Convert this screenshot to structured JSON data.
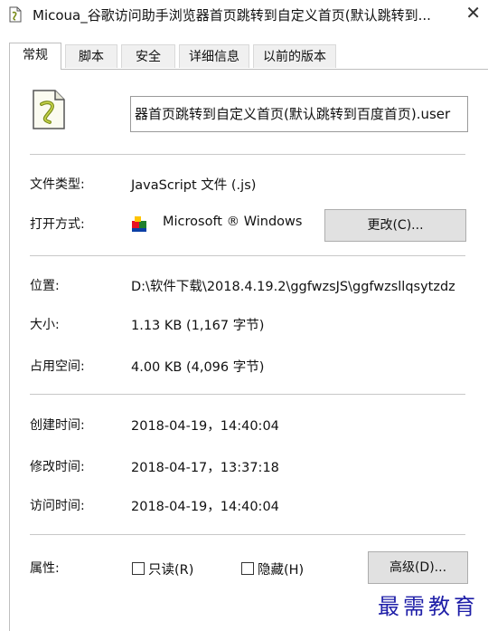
{
  "window": {
    "title": "Micoua_谷歌访问助手浏览器首页跳转到自定义首页(默认跳转到...",
    "close_glyph": "✕"
  },
  "tabs": [
    {
      "label": "常规",
      "active": true
    },
    {
      "label": "脚本",
      "active": false
    },
    {
      "label": "安全",
      "active": false
    },
    {
      "label": "详细信息",
      "active": false
    },
    {
      "label": "以前的版本",
      "active": false
    }
  ],
  "file": {
    "icon": "script-file-icon",
    "name_value": "器首页跳转到自定义首页(默认跳转到百度首页).user"
  },
  "type_row": {
    "label": "文件类型:",
    "value": "JavaScript 文件 (.js)"
  },
  "opens_with": {
    "label": "打开方式:",
    "icon": "windows-script-host-icon",
    "value": "Microsoft ® Windows",
    "change_button": "更改(C)..."
  },
  "location": {
    "label": "位置:",
    "value": "D:\\软件下载\\2018.4.19.2\\ggfwzsJS\\ggfwzsllqsytzdz"
  },
  "size": {
    "label": "大小:",
    "value": "1.13 KB (1,167 字节)"
  },
  "size_on_disk": {
    "label": "占用空间:",
    "value": "4.00 KB (4,096 字节)"
  },
  "created": {
    "label": "创建时间:",
    "value": "2018-04-19，14:40:04"
  },
  "modified": {
    "label": "修改时间:",
    "value": "2018-04-17，13:37:18"
  },
  "accessed": {
    "label": "访问时间:",
    "value": "2018-04-19，14:40:04"
  },
  "attributes": {
    "label": "属性:",
    "readonly_label": "只读(R)",
    "readonly_checked": false,
    "hidden_label": "隐藏(H)",
    "hidden_checked": false,
    "advanced_button": "高级(D)..."
  },
  "watermark": "最需教育",
  "colors": {
    "watermark": "#1f1fa8",
    "button_bg": "#e1e1e1",
    "border": "#bfbfbf"
  }
}
